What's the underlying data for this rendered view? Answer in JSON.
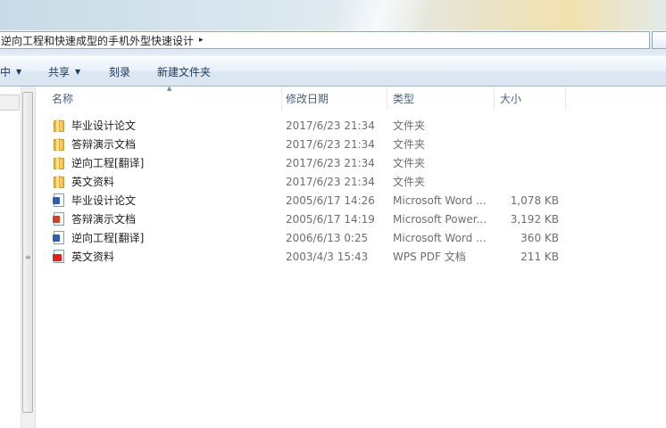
{
  "address": {
    "path": "逆向工程和快速成型的手机外型快速设计",
    "chevron": "▸"
  },
  "toolbar": {
    "items": [
      {
        "label": "中",
        "has_dropdown": true
      },
      {
        "label": "共享",
        "has_dropdown": true
      },
      {
        "label": "刻录",
        "has_dropdown": false
      },
      {
        "label": "新建文件夹",
        "has_dropdown": false
      }
    ]
  },
  "columns": {
    "name": "名称",
    "date": "修改日期",
    "type": "类型",
    "size": "大小"
  },
  "files": [
    {
      "name": "毕业设计论文",
      "date": "2017/6/23 21:34",
      "type": "文件夹",
      "size": "",
      "icon": "folder-icon"
    },
    {
      "name": "答辩演示文档",
      "date": "2017/6/23 21:34",
      "type": "文件夹",
      "size": "",
      "icon": "folder-icon"
    },
    {
      "name": "逆向工程[翻译]",
      "date": "2017/6/23 21:34",
      "type": "文件夹",
      "size": "",
      "icon": "folder-icon"
    },
    {
      "name": "英文资料",
      "date": "2017/6/23 21:34",
      "type": "文件夹",
      "size": "",
      "icon": "folder-icon"
    },
    {
      "name": "毕业设计论文",
      "date": "2005/6/17 14:26",
      "type": "Microsoft Word ...",
      "size": "1,078 KB",
      "icon": "word-doc-icon"
    },
    {
      "name": "答辩演示文档",
      "date": "2005/6/17 14:19",
      "type": "Microsoft Power...",
      "size": "3,192 KB",
      "icon": "powerpoint-icon"
    },
    {
      "name": "逆向工程[翻译]",
      "date": "2006/6/13 0:25",
      "type": "Microsoft Word ...",
      "size": "360 KB",
      "icon": "word-doc-icon"
    },
    {
      "name": "英文资料",
      "date": "2003/4/3 15:43",
      "type": "WPS PDF 文档",
      "size": "211 KB",
      "icon": "pdf-icon"
    }
  ]
}
